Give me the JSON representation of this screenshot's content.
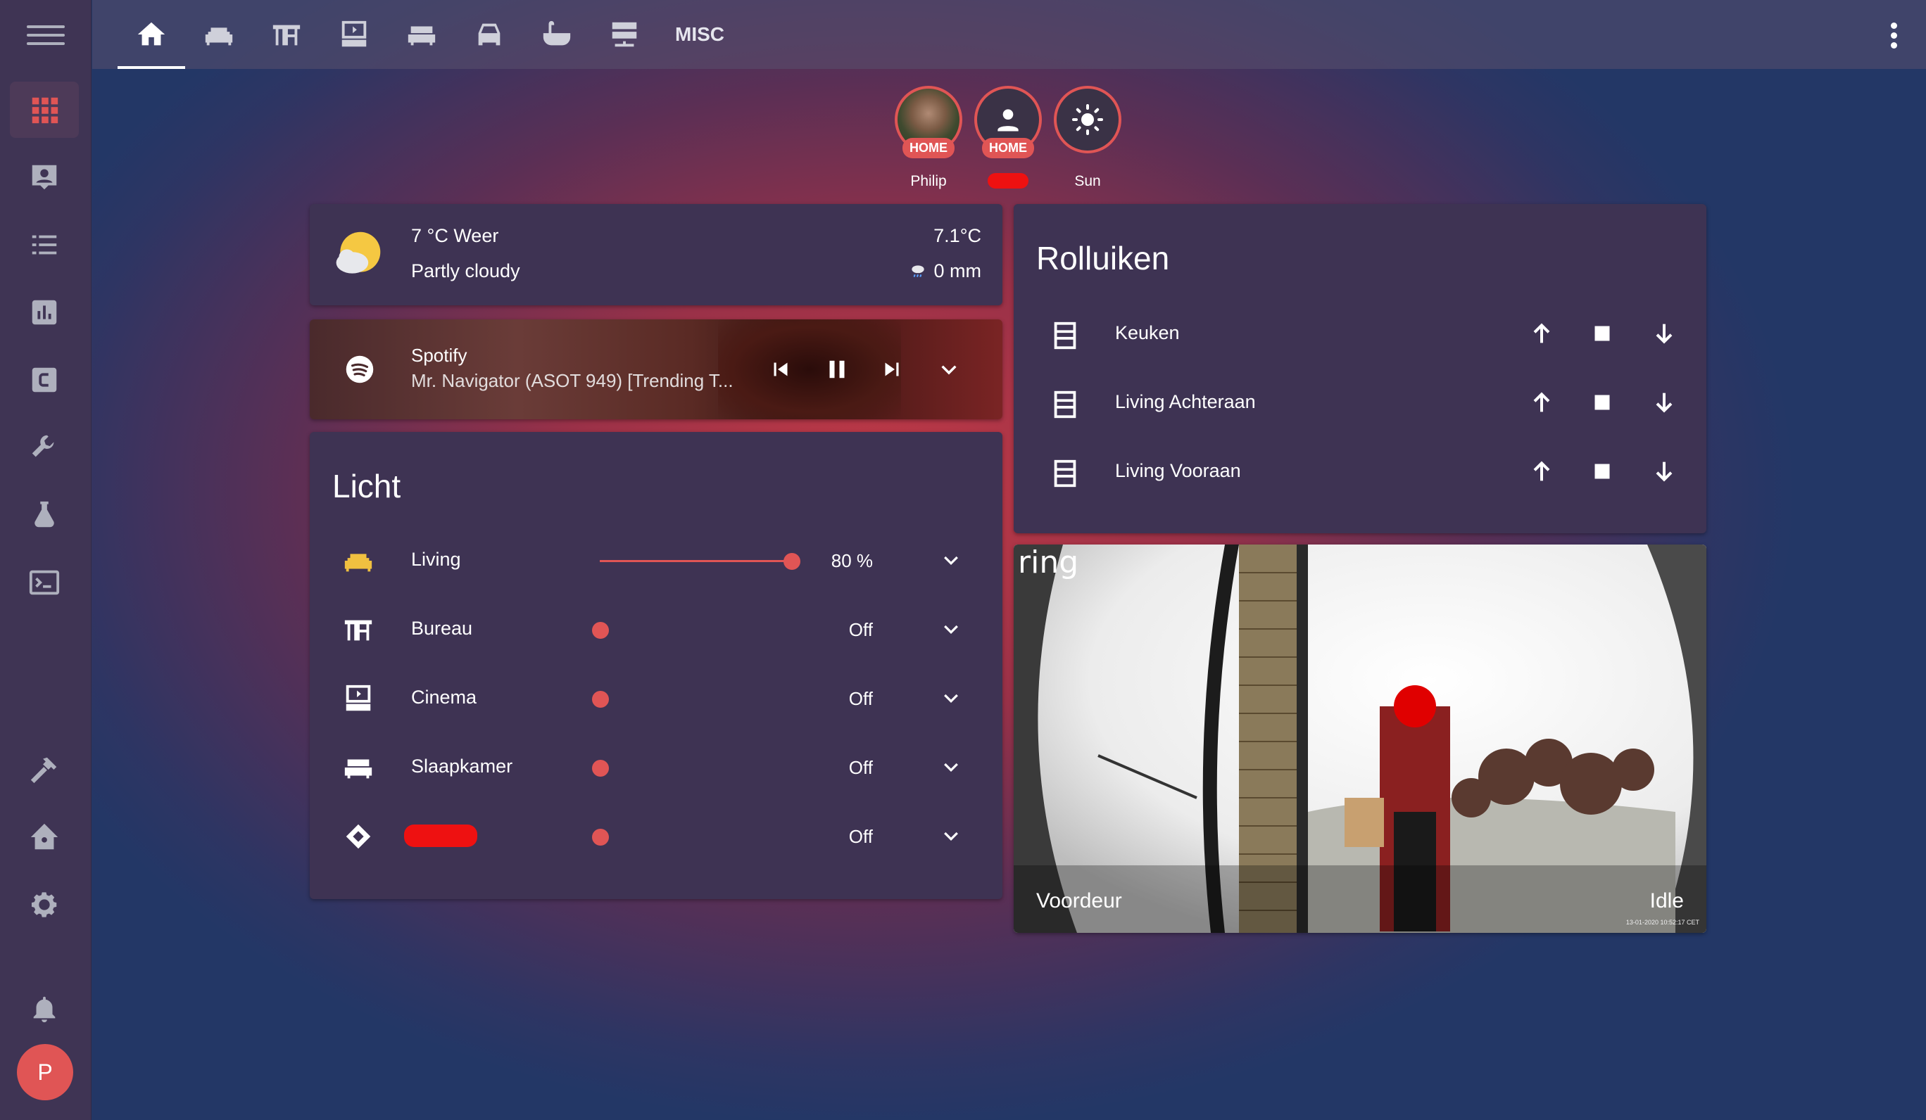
{
  "topbar": {
    "tabs": [
      "home-icon",
      "sofa-icon",
      "desk-icon",
      "cinema-icon",
      "bed-icon",
      "car-icon",
      "bathtub-icon",
      "server-icon"
    ],
    "misc_label": "MISC"
  },
  "sidebar": {
    "items": [
      "apps-icon",
      "account-box-icon",
      "list-icon",
      "chart-icon",
      "hacs-icon",
      "wrench-icon",
      "flask-icon",
      "terminal-icon",
      "hammer-icon",
      "home-assistant-icon",
      "cog-icon",
      "bell-icon"
    ],
    "user_initial": "P"
  },
  "badges": [
    {
      "name": "Philip",
      "state": "HOME"
    },
    {
      "name": "",
      "state": "HOME"
    },
    {
      "name": "Sun",
      "state": ""
    }
  ],
  "weather": {
    "title": "7 °C Weer",
    "condition": "Partly cloudy",
    "temperature": "7.1°C",
    "precipitation": "0 mm"
  },
  "spotify": {
    "source": "Spotify",
    "track": "Mr. Navigator (ASOT 949) [Trending T..."
  },
  "licht": {
    "title": "Licht",
    "rows": [
      {
        "label": "Living",
        "state": "80 %",
        "brightness": 80
      },
      {
        "label": "Bureau",
        "state": "Off"
      },
      {
        "label": "Cinema",
        "state": "Off"
      },
      {
        "label": "Slaapkamer",
        "state": "Off"
      },
      {
        "label": "",
        "state": "Off"
      }
    ]
  },
  "rolluiken": {
    "title": "Rolluiken",
    "rows": [
      {
        "label": "Keuken"
      },
      {
        "label": "Living Achteraan"
      },
      {
        "label": "Living Vooraan"
      }
    ]
  },
  "camera": {
    "brand": "ring",
    "name": "Voordeur",
    "state": "Idle",
    "timestamp": "13-01-2020 10:52:17 CET"
  },
  "colors": {
    "accent": "#e05555",
    "card": "#3e3353",
    "sidebar": "#3f3454",
    "sun": "#f5c842"
  }
}
